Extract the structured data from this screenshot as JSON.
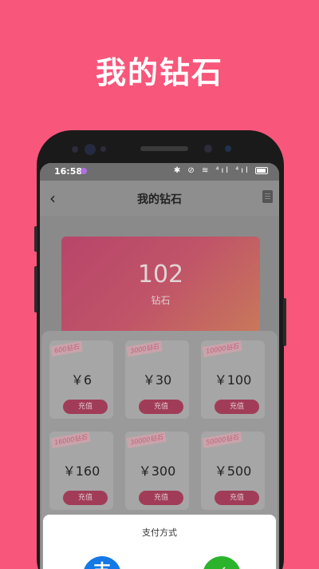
{
  "promo": {
    "title": "我的钻石"
  },
  "status_bar": {
    "time": "16:58",
    "icons": "✱ ⊘ ≋ ⁴ıl ⁴ıl"
  },
  "navbar": {
    "title": "我的钻石",
    "back_icon": "chevron-left-icon",
    "record_icon": "book-icon"
  },
  "balance": {
    "value": "102",
    "unit": "钻石"
  },
  "packages": [
    {
      "tag": "600钻石",
      "price": "￥6",
      "button": "充值"
    },
    {
      "tag": "3000钻石",
      "price": "￥30",
      "button": "充值"
    },
    {
      "tag": "10000钻石",
      "price": "￥100",
      "button": "充值"
    },
    {
      "tag": "16000钻石",
      "price": "￥160",
      "button": "充值"
    },
    {
      "tag": "30000钻石",
      "price": "￥300",
      "button": "充值"
    },
    {
      "tag": "50000钻石",
      "price": "￥500",
      "button": "充值"
    }
  ],
  "payment": {
    "title": "支付方式",
    "methods": [
      {
        "glyph": "支",
        "icon": "alipay-icon"
      },
      {
        "glyph": "✓",
        "icon": "wechat-pay-icon"
      }
    ]
  },
  "colors": {
    "background": "#F8567A",
    "card_gradient_start": "#b8456a",
    "button": "#a13c58",
    "alipay": "#1478e6",
    "wechat": "#2bb32b"
  }
}
